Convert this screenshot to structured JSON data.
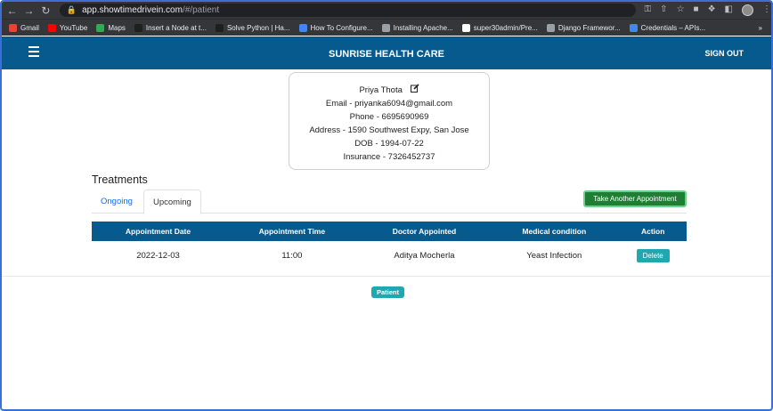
{
  "browser": {
    "url_host": "app.showtimedrivein.com",
    "url_path": "/#/patient",
    "bookmarks": [
      {
        "label": "Gmail",
        "color": "#ea4335"
      },
      {
        "label": "YouTube",
        "color": "#ff0000"
      },
      {
        "label": "Maps",
        "color": "#34a853"
      },
      {
        "label": "Insert a Node at t...",
        "color": "#1f1f1f"
      },
      {
        "label": "Solve Python | Ha...",
        "color": "#1f1f1f"
      },
      {
        "label": "How To Configure...",
        "color": "#4285f4"
      },
      {
        "label": "Installing Apache...",
        "color": "#9aa0a6"
      },
      {
        "label": "super30admin/Pre...",
        "color": "#ffffff"
      },
      {
        "label": "Django Framewor...",
        "color": "#9aa0a6"
      },
      {
        "label": "Credentials – APIs...",
        "color": "#4285f4"
      }
    ],
    "more": "»"
  },
  "header": {
    "title": "SUNRISE HEALTH CARE",
    "signout": "SIGN OUT"
  },
  "profile": {
    "name": "Priya Thota",
    "email": "Email - priyanka6094@gmail.com",
    "phone": "Phone - 6695690969",
    "address": "Address - 1590 Southwest Expy, San Jose",
    "dob": "DOB - 1994-07-22",
    "insurance": "Insurance - 7326452737"
  },
  "treatments": {
    "heading": "Treatments",
    "tabs": [
      "Ongoing",
      "Upcoming"
    ],
    "take_button": "Take Another Appointment",
    "columns": [
      "Appointment Date",
      "Appointment Time",
      "Doctor Appointed",
      "Medical condition",
      "Action"
    ],
    "rows": [
      {
        "date": "2022-12-03",
        "time": "11:00",
        "doctor": "Aditya Mocherla",
        "condition": "Yeast Infection",
        "action": "Delete"
      }
    ]
  },
  "role_badge": "Patient",
  "colors": {
    "primary": "#065a8e",
    "accent": "#20a8b0",
    "success": "#1e7e34"
  }
}
